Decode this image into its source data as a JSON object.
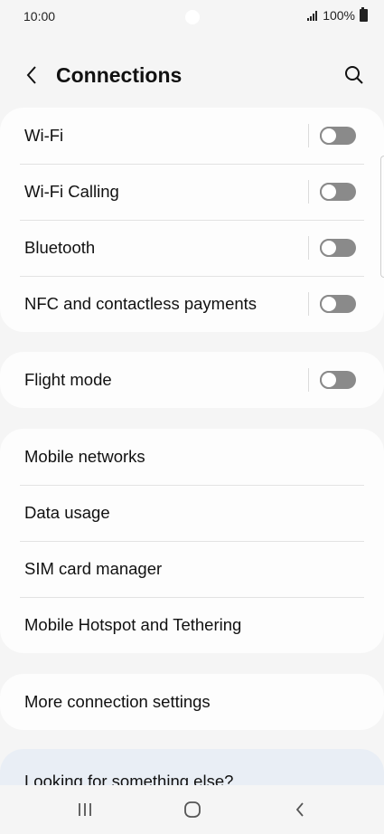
{
  "status": {
    "time": "10:00",
    "battery": "100%"
  },
  "header": {
    "title": "Connections"
  },
  "group1": [
    {
      "label": "Wi-Fi",
      "toggle": false
    },
    {
      "label": "Wi-Fi Calling",
      "toggle": false
    },
    {
      "label": "Bluetooth",
      "toggle": false
    },
    {
      "label": "NFC and contactless payments",
      "toggle": false
    }
  ],
  "group2": [
    {
      "label": "Flight mode",
      "toggle": false
    }
  ],
  "group3": [
    {
      "label": "Mobile networks"
    },
    {
      "label": "Data usage"
    },
    {
      "label": "SIM card manager"
    },
    {
      "label": "Mobile Hotspot and Tethering"
    }
  ],
  "group4": [
    {
      "label": "More connection settings"
    }
  ],
  "looking": {
    "label": "Looking for something else?"
  }
}
